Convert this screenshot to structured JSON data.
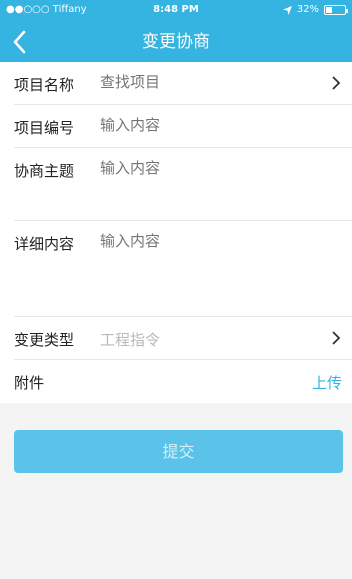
{
  "status_bar": {
    "carrier": "●●○○○ Tiffany",
    "time": "8:48 PM",
    "battery": "32%",
    "battery_level": 0.32
  },
  "nav": {
    "title": "变更协商"
  },
  "form": {
    "project_name": {
      "label": "项目名称",
      "placeholder": "查找项目"
    },
    "project_number": {
      "label": "项目编号",
      "placeholder": "输入内容"
    },
    "topic": {
      "label": "协商主题",
      "placeholder": "输入内容"
    },
    "details": {
      "label": "详细内容",
      "placeholder": "输入内容"
    },
    "change_type": {
      "label": "变更类型",
      "value": "工程指令"
    },
    "attachment": {
      "label": "附件",
      "upload_label": "上传"
    }
  },
  "submit_label": "提交",
  "colors": {
    "accent": "#35b3e1",
    "button": "#5bc3e9"
  }
}
